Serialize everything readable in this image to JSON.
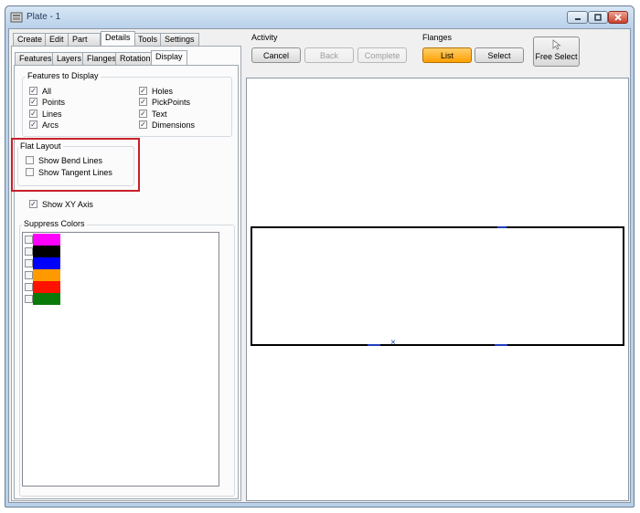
{
  "window": {
    "title": "Plate - 1",
    "app_icon": "plate-app-icon",
    "caption_icons": [
      "minimize-icon",
      "maximize-icon",
      "close-icon"
    ]
  },
  "tabs": {
    "main": [
      {
        "label": "Create",
        "active": false
      },
      {
        "label": "Edit",
        "active": false
      },
      {
        "label": "Part",
        "active": false
      },
      {
        "label": "Details",
        "active": true
      },
      {
        "label": "Tools",
        "active": false
      },
      {
        "label": "Settings",
        "active": false
      }
    ],
    "sub": [
      {
        "label": "Features",
        "active": false
      },
      {
        "label": "Layers",
        "active": false
      },
      {
        "label": "Flanges",
        "active": false
      },
      {
        "label": "Rotation",
        "active": false
      },
      {
        "label": "Display",
        "active": true
      }
    ]
  },
  "display": {
    "features_group": {
      "title": "Features to Display",
      "left": [
        {
          "label": "All",
          "checked": true
        },
        {
          "label": "Points",
          "checked": true
        },
        {
          "label": "Lines",
          "checked": true
        },
        {
          "label": "Arcs",
          "checked": true
        }
      ],
      "right": [
        {
          "label": "Holes",
          "checked": true
        },
        {
          "label": "PickPoints",
          "checked": true
        },
        {
          "label": "Text",
          "checked": true
        },
        {
          "label": "Dimensions",
          "checked": true
        }
      ]
    },
    "flat_layout": {
      "title": "Flat Layout",
      "highlight_color": "#c8202a",
      "items": [
        {
          "label": "Show Bend Lines",
          "checked": false
        },
        {
          "label": "Show Tangent Lines",
          "checked": false
        }
      ]
    },
    "show_xy_axis": {
      "label": "Show XY Axis",
      "checked": true
    },
    "suppress_colors": {
      "title": "Suppress Colors",
      "colors": [
        "#ff00ff",
        "#000000",
        "#0000ff",
        "#ff9900",
        "#ff1100",
        "#0a7a0a"
      ]
    }
  },
  "activity": {
    "title": "Activity",
    "buttons": [
      {
        "label": "Cancel",
        "enabled": true
      },
      {
        "label": "Back",
        "enabled": false
      },
      {
        "label": "Complete",
        "enabled": false
      }
    ]
  },
  "flanges": {
    "title": "Flanges",
    "buttons": [
      {
        "label": "List",
        "selected": true,
        "color": "#ffa500"
      },
      {
        "label": "Select",
        "selected": false
      }
    ]
  },
  "free_select": {
    "label": "Free Select",
    "icon": "cursor-arrow-icon"
  },
  "canvas": {
    "axis_marker": "×",
    "accent": "#1f3fbf"
  }
}
